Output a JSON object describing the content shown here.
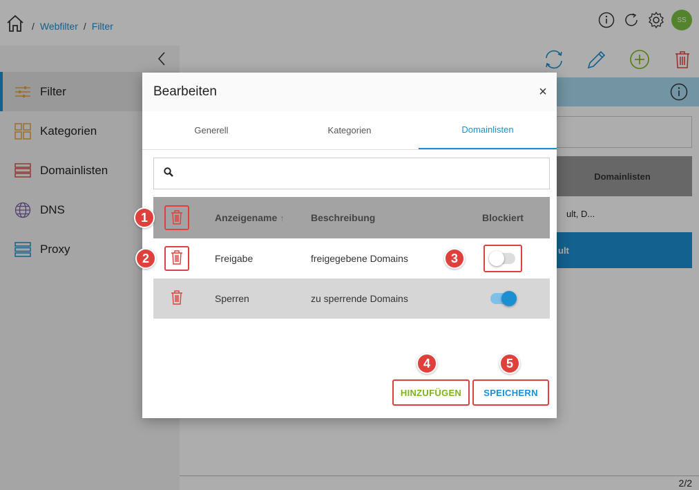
{
  "breadcrumb": {
    "sep": "/",
    "items": [
      "Webfilter",
      "Filter"
    ]
  },
  "user": {
    "initials": "SS"
  },
  "sidebar": {
    "items": [
      {
        "label": "Filter",
        "icon": "sliders-icon",
        "active": true
      },
      {
        "label": "Kategorien",
        "icon": "grid-icon"
      },
      {
        "label": "Domainlisten",
        "icon": "list-icon"
      },
      {
        "label": "DNS",
        "icon": "globe-icon"
      },
      {
        "label": "Proxy",
        "icon": "server-icon"
      }
    ]
  },
  "background": {
    "column_header": "Domainlisten",
    "cell_text": "ult, D...",
    "button_text": "ult",
    "pager": "2/2"
  },
  "modal": {
    "title": "Bearbeiten",
    "close": "×",
    "tabs": [
      "Generell",
      "Kategorien",
      "Domainlisten"
    ],
    "active_tab": "Domainlisten",
    "search": {
      "value": "",
      "placeholder": ""
    },
    "table": {
      "headers": {
        "name": "Anzeigename",
        "sort": "↑",
        "description": "Beschreibung",
        "blocked": "Blockiert"
      },
      "rows": [
        {
          "name": "Freigabe",
          "description": "freigegebene Domains",
          "blocked": false
        },
        {
          "name": "Sperren",
          "description": "zu sperrende Domains",
          "blocked": true
        }
      ]
    },
    "buttons": {
      "add": "HINZUFÜGEN",
      "save": "SPEICHERN"
    }
  },
  "annotations": [
    "1",
    "2",
    "3",
    "4",
    "5"
  ],
  "colors": {
    "accent": "#1b8fd1",
    "add": "#7cb518",
    "danger": "#e0403b"
  }
}
